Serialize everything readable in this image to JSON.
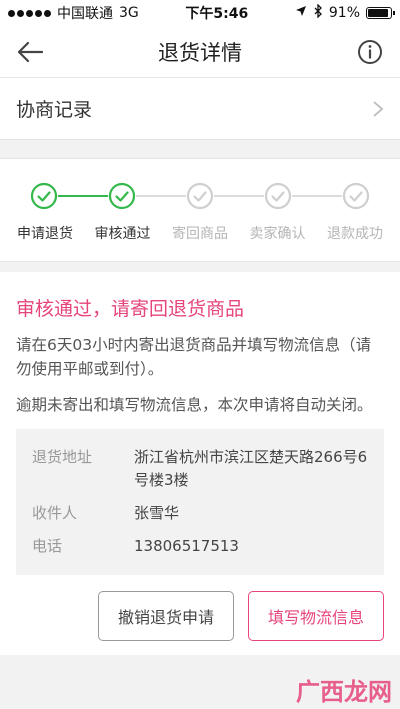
{
  "status": {
    "carrier": "中国联通",
    "network": "3G",
    "time": "下午5:46",
    "battery": "91%",
    "battery_level": 0.91
  },
  "nav": {
    "title": "退货详情"
  },
  "record": {
    "label": "协商记录"
  },
  "steps": {
    "completed_count": 2,
    "items": [
      {
        "label": "申请退货",
        "state": "done"
      },
      {
        "label": "审核通过",
        "state": "done"
      },
      {
        "label": "寄回商品",
        "state": "todo"
      },
      {
        "label": "卖家确认",
        "state": "todo"
      },
      {
        "label": "退款成功",
        "state": "todo"
      }
    ]
  },
  "content": {
    "headline": "审核通过，请寄回退货商品",
    "para1": "请在6天03小时内寄出退货商品并填写物流信息（请勿使用平邮或到付）。",
    "para2": "逾期未寄出和填写物流信息，本次申请将自动关闭。"
  },
  "address": {
    "address_label": "退货地址",
    "address_value": "浙江省杭州市滨江区楚天路266号6号楼3楼",
    "receiver_label": "收件人",
    "receiver_value": "张雪华",
    "phone_label": "电话",
    "phone_value": "13806517513"
  },
  "actions": {
    "cancel_label": "撤销退货申请",
    "fill_label": "填写物流信息"
  },
  "watermark": {
    "text": "广西龙网"
  },
  "colors": {
    "accent": "#e6457a",
    "step_done": "#35b84b",
    "step_todo": "#cfcfcf"
  }
}
